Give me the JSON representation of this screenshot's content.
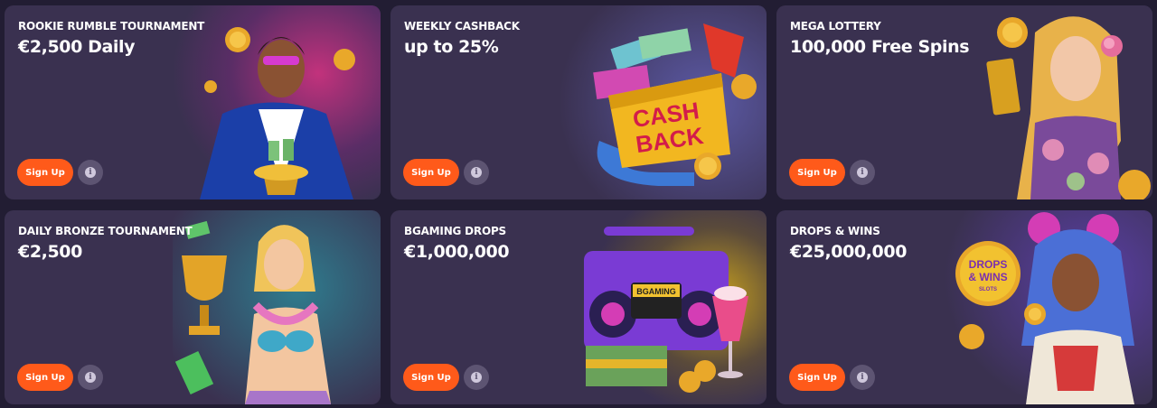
{
  "promos": [
    {
      "title": "ROOKIE RUMBLE TOURNAMENT",
      "prize": "€2,500 Daily",
      "cta": "Sign Up",
      "info_icon": "i"
    },
    {
      "title": "WEEKLY CASHBACK",
      "prize": "up to 25%",
      "cta": "Sign Up",
      "info_icon": "i",
      "art_text": [
        "CASH",
        "BACK"
      ]
    },
    {
      "title": "MEGA LOTTERY",
      "prize": "100,000 Free Spins",
      "cta": "Sign Up",
      "info_icon": "i"
    },
    {
      "title": "DAILY BRONZE TOURNAMENT",
      "prize": "€2,500",
      "cta": "Sign Up",
      "info_icon": "i"
    },
    {
      "title": "BGAMING DROPS",
      "prize": "€1,000,000",
      "cta": "Sign Up",
      "info_icon": "i",
      "art_text": [
        "BGAMING"
      ]
    },
    {
      "title": "DROPS & WINS",
      "prize": "€25,000,000",
      "cta": "Sign Up",
      "info_icon": "i",
      "art_text": [
        "DROPS",
        "& WINS",
        "SLOTS"
      ]
    }
  ],
  "colors": {
    "card_bg": "#3a3150",
    "page_bg": "#221d33",
    "cta": "#ff5a1a",
    "info_bg": "#5d5472"
  }
}
